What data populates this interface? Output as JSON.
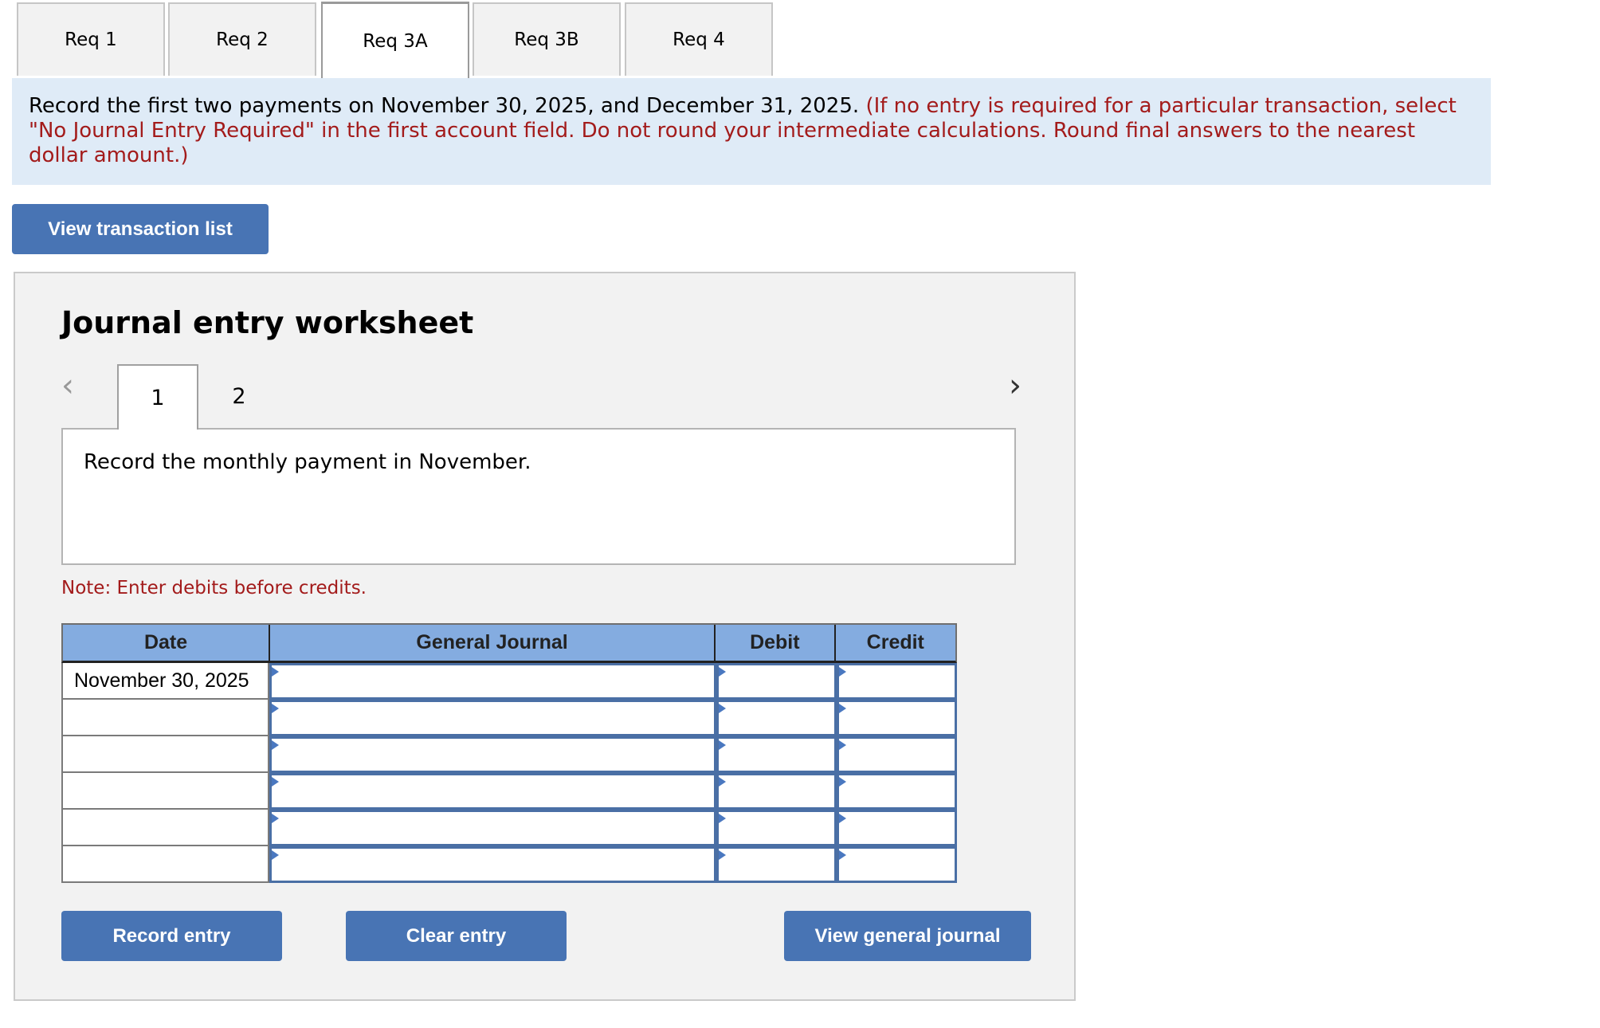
{
  "tabs": [
    {
      "label": "Req 1",
      "active": false
    },
    {
      "label": "Req 2",
      "active": false
    },
    {
      "label": "Req 3A",
      "active": true
    },
    {
      "label": "Req 3B",
      "active": false
    },
    {
      "label": "Req 4",
      "active": false
    }
  ],
  "instructions": {
    "main": "Record the first two payments on November 30, 2025, and December 31, 2025.",
    "note": "(If no entry is required for a particular transaction, select \"No Journal Entry Required\" in the first account field. Do not round your intermediate calculations. Round final answers to the nearest dollar amount.)"
  },
  "view_transaction_list_label": "View transaction list",
  "worksheet": {
    "title": "Journal entry worksheet",
    "prev_icon": "chevron-left-icon",
    "next_icon": "chevron-right-icon",
    "entries": [
      {
        "label": "1",
        "active": true
      },
      {
        "label": "2",
        "active": false
      }
    ],
    "description": "Record the monthly payment in November.",
    "note": "Note: Enter debits before credits.",
    "columns": [
      "Date",
      "General Journal",
      "Debit",
      "Credit"
    ],
    "rows": [
      {
        "date": "November 30, 2025",
        "account": "",
        "debit": "",
        "credit": ""
      },
      {
        "date": "",
        "account": "",
        "debit": "",
        "credit": ""
      },
      {
        "date": "",
        "account": "",
        "debit": "",
        "credit": ""
      },
      {
        "date": "",
        "account": "",
        "debit": "",
        "credit": ""
      },
      {
        "date": "",
        "account": "",
        "debit": "",
        "credit": ""
      },
      {
        "date": "",
        "account": "",
        "debit": "",
        "credit": ""
      }
    ],
    "buttons": {
      "record": "Record entry",
      "clear": "Clear entry",
      "view_journal": "View general journal"
    }
  }
}
